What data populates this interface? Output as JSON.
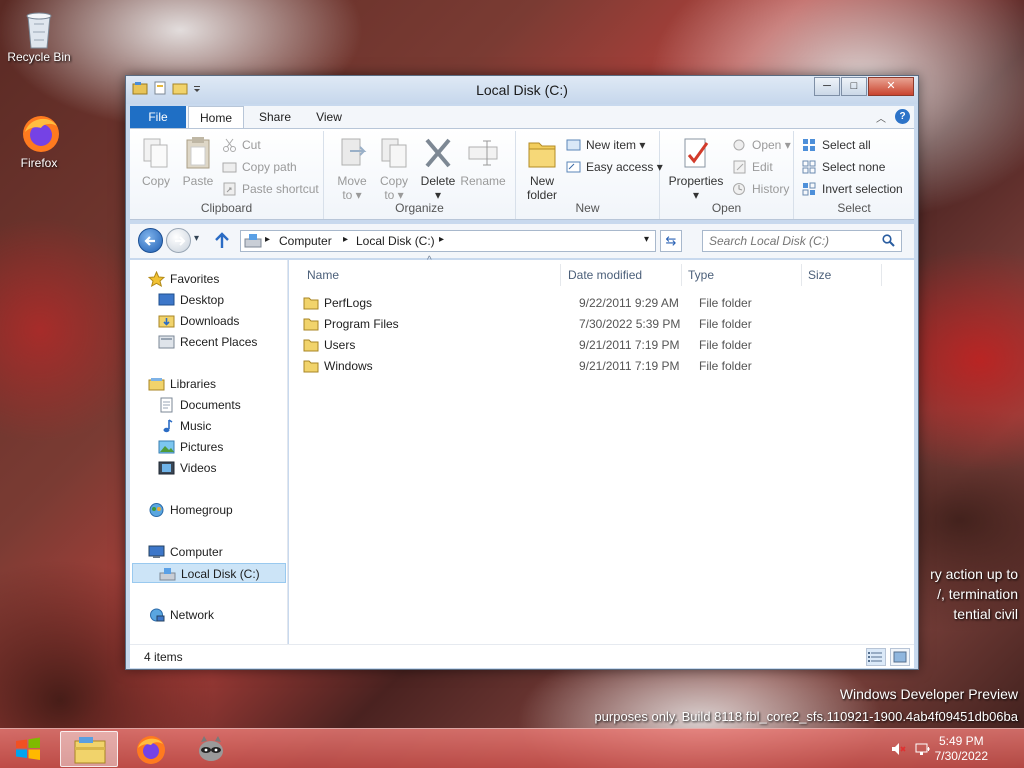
{
  "desktop": {
    "icons": [
      {
        "label": "Recycle Bin",
        "icon": "recycle-bin-icon"
      },
      {
        "label": "Firefox",
        "icon": "firefox-icon"
      }
    ],
    "partial_text": [
      "ry action up to",
      "/, termination",
      "tential civil"
    ],
    "watermark_title": "Windows Developer Preview",
    "watermark_build": "purposes only. Build 8118.fbl_core2_sfs.110921-1900.4ab4f09451db06ba"
  },
  "window": {
    "title": "Local Disk (C:)",
    "controls": {
      "minimize": "─",
      "maximize": "□",
      "close": "✕"
    }
  },
  "ribbon": {
    "tabs": {
      "file": "File",
      "home": "Home",
      "share": "Share",
      "view": "View"
    },
    "help": "?",
    "caret": "︿",
    "clipboard": {
      "group": "Clipboard",
      "copy": "Copy",
      "paste": "Paste",
      "cut": "Cut",
      "copy_path": "Copy path",
      "paste_shortcut": "Paste shortcut"
    },
    "organize": {
      "group": "Organize",
      "move_to_1": "Move",
      "move_to_2": "to ▾",
      "copy_to_1": "Copy",
      "copy_to_2": "to ▾",
      "delete": "Delete",
      "delete_arrow": "▾",
      "rename": "Rename"
    },
    "new": {
      "group": "New",
      "new_folder_1": "New",
      "new_folder_2": "folder",
      "new_item": "New item ▾",
      "easy_access": "Easy access ▾"
    },
    "open": {
      "group": "Open",
      "properties": "Properties",
      "properties_arrow": "▾",
      "open": "Open ▾",
      "edit": "Edit",
      "history": "History"
    },
    "select": {
      "group": "Select",
      "select_all": "Select all",
      "select_none": "Select none",
      "invert": "Invert selection"
    }
  },
  "addressbar": {
    "sep": "▸",
    "path": [
      "Computer",
      "Local Disk (C:)"
    ],
    "dropdown": "▾",
    "refresh": "⇆",
    "search_placeholder": "Search Local Disk (C:)"
  },
  "navpane": {
    "favorites": "Favorites",
    "favorites_items": [
      "Desktop",
      "Downloads",
      "Recent Places"
    ],
    "libraries": "Libraries",
    "libraries_items": [
      "Documents",
      "Music",
      "Pictures",
      "Videos"
    ],
    "homegroup": "Homegroup",
    "computer": "Computer",
    "computer_items": [
      "Local Disk (C:)"
    ],
    "network": "Network"
  },
  "filelist": {
    "sort_arrow": "^",
    "columns": {
      "name": "Name",
      "date": "Date modified",
      "type": "Type",
      "size": "Size"
    },
    "rows": [
      {
        "name": "PerfLogs",
        "date": "9/22/2011 9:29 AM",
        "type": "File folder",
        "size": ""
      },
      {
        "name": "Program Files",
        "date": "7/30/2022 5:39 PM",
        "type": "File folder",
        "size": ""
      },
      {
        "name": "Users",
        "date": "9/21/2011 7:19 PM",
        "type": "File folder",
        "size": ""
      },
      {
        "name": "Windows",
        "date": "9/21/2011 7:19 PM",
        "type": "File folder",
        "size": ""
      }
    ]
  },
  "status": {
    "items": "4 items"
  },
  "taskbar": {
    "time": "5:49 PM",
    "date": "7/30/2022",
    "apps": [
      "start-button",
      "file-explorer",
      "firefox",
      "raccoon-app"
    ]
  }
}
